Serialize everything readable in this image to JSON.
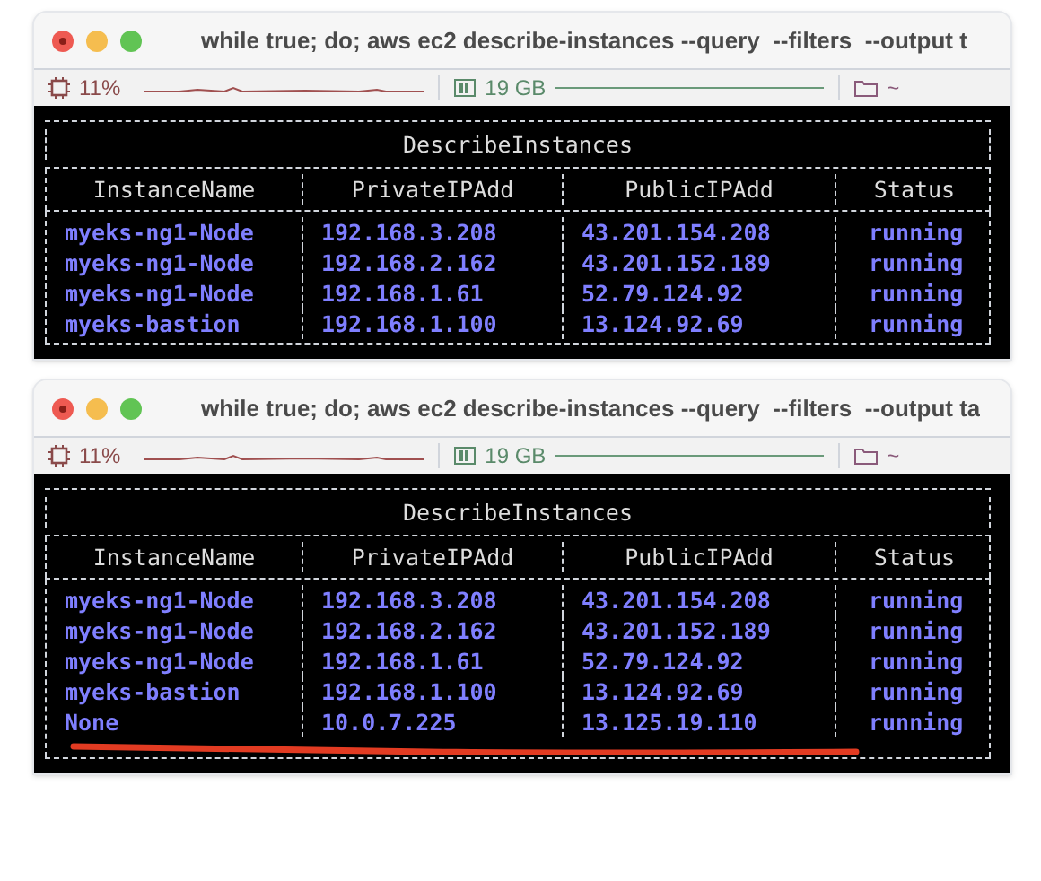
{
  "windows": [
    {
      "title": "while true; do; aws ec2 describe-instances --query  --filters  --output t",
      "cpu": "11%",
      "memory": "19 GB",
      "folder": "~",
      "red_underline": false,
      "table": {
        "title": "DescribeInstances",
        "columns": [
          "InstanceName",
          "PrivateIPAdd",
          "PublicIPAdd",
          "Status"
        ],
        "rows": [
          [
            "myeks-ng1-Node",
            "192.168.3.208",
            "43.201.154.208",
            "running"
          ],
          [
            "myeks-ng1-Node",
            "192.168.2.162",
            "43.201.152.189",
            "running"
          ],
          [
            "myeks-ng1-Node",
            "192.168.1.61",
            "52.79.124.92",
            "running"
          ],
          [
            "myeks-bastion",
            "192.168.1.100",
            "13.124.92.69",
            "running"
          ]
        ]
      }
    },
    {
      "title": "while true; do; aws ec2 describe-instances --query  --filters  --output ta",
      "cpu": "11%",
      "memory": "19 GB",
      "folder": "~",
      "red_underline": true,
      "table": {
        "title": "DescribeInstances",
        "columns": [
          "InstanceName",
          "PrivateIPAdd",
          "PublicIPAdd",
          "Status"
        ],
        "rows": [
          [
            "myeks-ng1-Node",
            "192.168.3.208",
            "43.201.154.208",
            "running"
          ],
          [
            "myeks-ng1-Node",
            "192.168.2.162",
            "43.201.152.189",
            "running"
          ],
          [
            "myeks-ng1-Node",
            "192.168.1.61",
            "52.79.124.92",
            "running"
          ],
          [
            "myeks-bastion",
            "192.168.1.100",
            "13.124.92.69",
            "running"
          ],
          [
            "None",
            "10.0.7.225",
            "13.125.19.110",
            "running"
          ]
        ]
      }
    }
  ]
}
